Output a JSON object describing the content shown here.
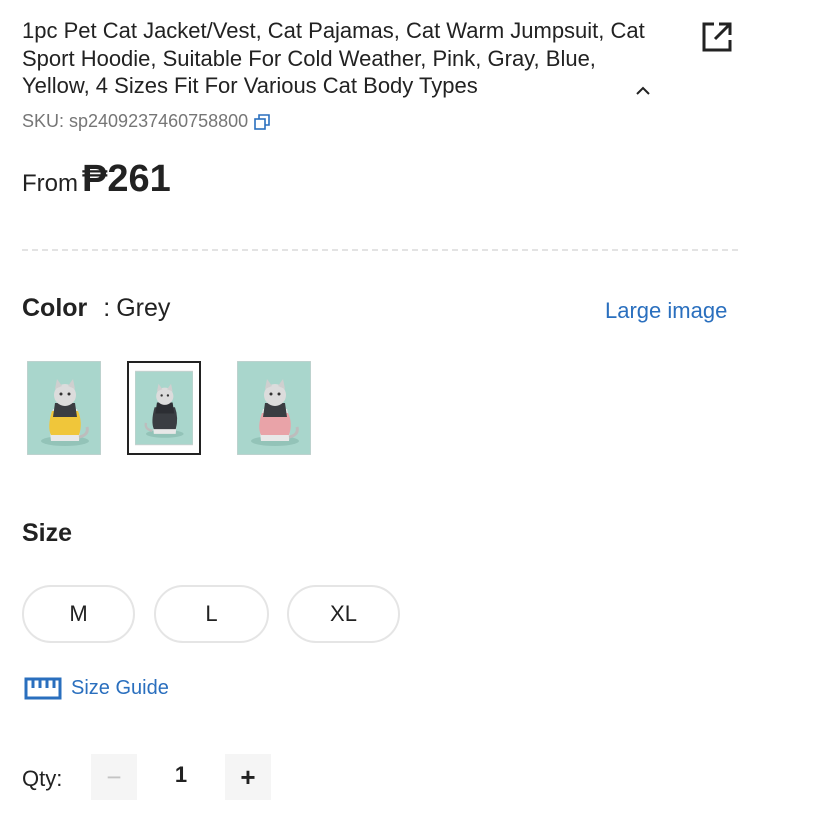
{
  "product": {
    "title": "1pc Pet Cat Jacket/Vest, Cat Pajamas, Cat Warm Jumpsuit, Cat Sport Hoodie, Suitable For Cold Weather, Pink, Gray, Blue, Yellow, 4 Sizes Fit For Various Cat Body Types",
    "sku": "SKU: sp2409237460758800"
  },
  "price": {
    "prefix": "From",
    "amount": "₱261"
  },
  "color": {
    "label": "Color",
    "separator": ":",
    "selected": "Grey",
    "large_image_link": "Large image",
    "swatches": [
      {
        "name": "yellow-vest",
        "vest_color": "#f0c63a",
        "selected": false
      },
      {
        "name": "grey-vest",
        "vest_color": "#3a3d42",
        "selected": true
      },
      {
        "name": "pink-vest",
        "vest_color": "#e9a3a8",
        "selected": false
      }
    ]
  },
  "size": {
    "label": "Size",
    "options": [
      "M",
      "L",
      "XL"
    ],
    "guide_link": "Size Guide"
  },
  "quantity": {
    "label": "Qty:",
    "value": "1",
    "minus": "−",
    "plus": "+"
  },
  "colors": {
    "link": "#2a6fbe",
    "text": "#222222",
    "muted": "#767676",
    "border": "#e5e5e5",
    "swatch_bg": "#a9d6cc"
  },
  "icons": [
    "share-icon",
    "chevron-up-icon",
    "copy-icon",
    "ruler-icon"
  ]
}
